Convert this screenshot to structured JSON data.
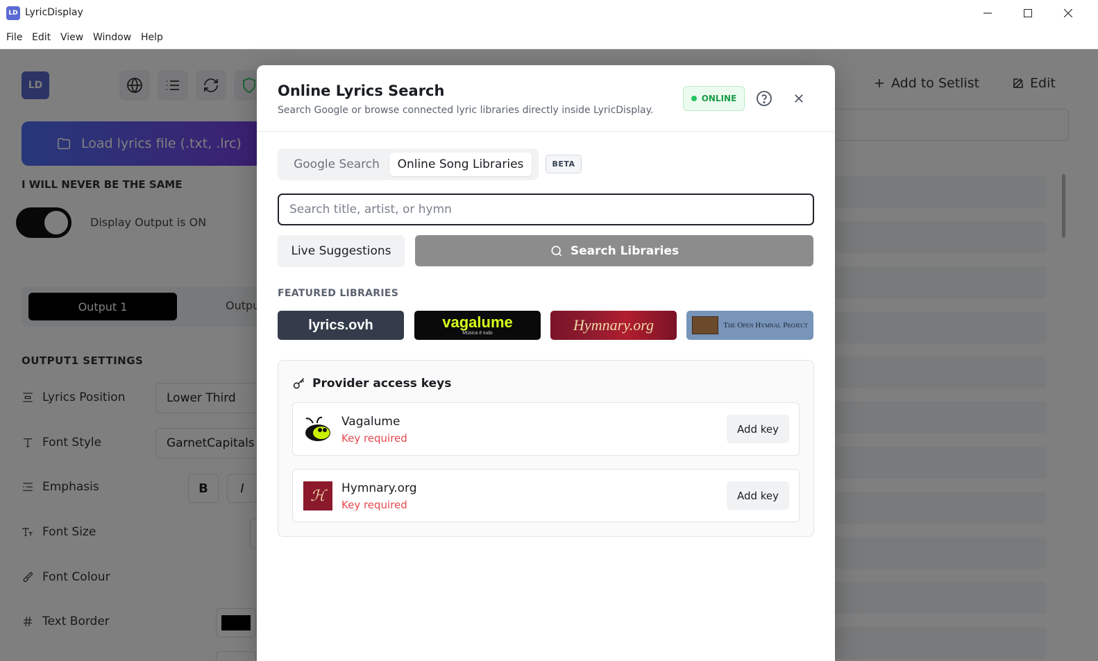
{
  "window": {
    "title": "LyricDisplay",
    "app_icon": "LD"
  },
  "menu": [
    "File",
    "Edit",
    "View",
    "Window",
    "Help"
  ],
  "background": {
    "logo": "LD",
    "load_button": "Load lyrics file (.txt, .lrc)",
    "song_title": "I WILL NEVER BE THE SAME",
    "toggle_label": "Display Output is ON",
    "output_tab_active": "Output 1",
    "output_tab_other": "Outpu",
    "settings_title": "OUTPUT1 SETTINGS",
    "settings": [
      {
        "label": "Lyrics Position",
        "value": "Lower Third"
      },
      {
        "label": "Font Style",
        "value": "GarnetCapitals"
      },
      {
        "label": "Emphasis",
        "bold": "B",
        "italic": "I"
      },
      {
        "label": "Font Size"
      },
      {
        "label": "Font Colour"
      },
      {
        "label": "Text Border"
      }
    ],
    "add_to_setlist": "Add to Setlist",
    "edit": "Edit"
  },
  "modal": {
    "title": "Online Lyrics Search",
    "subtitle": "Search Google or browse connected lyric libraries directly inside LyricDisplay.",
    "status": "ONLINE",
    "tabs": [
      {
        "label": "Google Search",
        "active": false
      },
      {
        "label": "Online Song Libraries",
        "active": true
      }
    ],
    "beta_badge": "BETA",
    "search_placeholder": "Search title, artist, or hymn",
    "search_value": "",
    "live_suggestions": "Live Suggestions",
    "search_button": "Search Libraries",
    "featured_title": "FEATURED LIBRARIES",
    "libraries": [
      {
        "name": "lyrics.ovh"
      },
      {
        "name": "vagalume",
        "tagline": "Música é tudo"
      },
      {
        "name": "Hymnary.org"
      },
      {
        "name": "The Open Hymnal Project"
      }
    ],
    "keys": {
      "title": "Provider access keys",
      "providers": [
        {
          "name": "Vagalume",
          "status": "Key required",
          "button": "Add key"
        },
        {
          "name": "Hymnary.org",
          "status": "Key required",
          "button": "Add key"
        }
      ]
    }
  },
  "colors": {
    "online_green": "#22c55e",
    "error_red": "#e5484d",
    "primary_gradient_start": "#4f6ff5",
    "primary_gradient_end": "#7b3fe4"
  }
}
